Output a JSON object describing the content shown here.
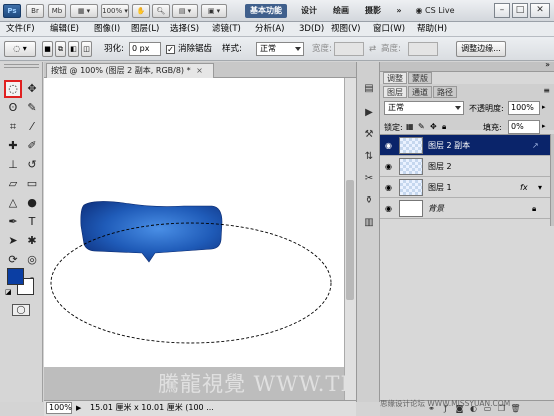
{
  "app": {
    "logo": "Ps",
    "launcher_buttons": [
      "Br",
      "Mb"
    ],
    "workspaces": [
      "基本功能",
      "设计",
      "绘画",
      "摄影"
    ],
    "more": "»",
    "cslive": "CS Live"
  },
  "menu": [
    "文件(F)",
    "编辑(E)",
    "图像(I)",
    "图层(L)",
    "选择(S)",
    "滤镜(T)",
    "分析(A)",
    "3D(D)",
    "视图(V)",
    "窗口(W)",
    "帮助(H)"
  ],
  "options": {
    "feather_label": "羽化:",
    "feather_value": "0 px",
    "antialias_label": "消除锯齿",
    "style_label": "样式:",
    "style_value": "正常",
    "width_label": "宽度:",
    "height_label": "高度:",
    "refine_button": "调整边缘..."
  },
  "document": {
    "tab_title": "按钮 @ 100% (图层 2 副本, RGB/8) *",
    "zoom": "100%",
    "doc_info": "15.01 厘米 x 10.01 厘米 (100 ..."
  },
  "panel": {
    "top_tabs": [
      "调整",
      "蒙版"
    ],
    "layer_tabs": [
      "图层",
      "通道",
      "路径"
    ],
    "blend_mode": "正常",
    "opacity_label": "不透明度:",
    "opacity_value": "100%",
    "lock_label": "锁定:",
    "fill_label": "填充:",
    "fill_value": "0%",
    "layers": [
      {
        "name": "图层 2 副本",
        "selected": true,
        "fx": false,
        "lock": false
      },
      {
        "name": "图层 2",
        "selected": false,
        "fx": false,
        "lock": false
      },
      {
        "name": "图层 1",
        "selected": false,
        "fx": true,
        "lock": false
      },
      {
        "name": "背景",
        "selected": false,
        "fx": false,
        "lock": true
      }
    ]
  },
  "watermark": "騰龍視覺 WWW.TLVI.NET",
  "watermark2": "思缘设计论坛  WWW.MISSYUAN.COM",
  "colors": {
    "accent": "#0a246a",
    "button_blue": "#1f5bb8",
    "fg_swatch": "#0b3ea3"
  }
}
